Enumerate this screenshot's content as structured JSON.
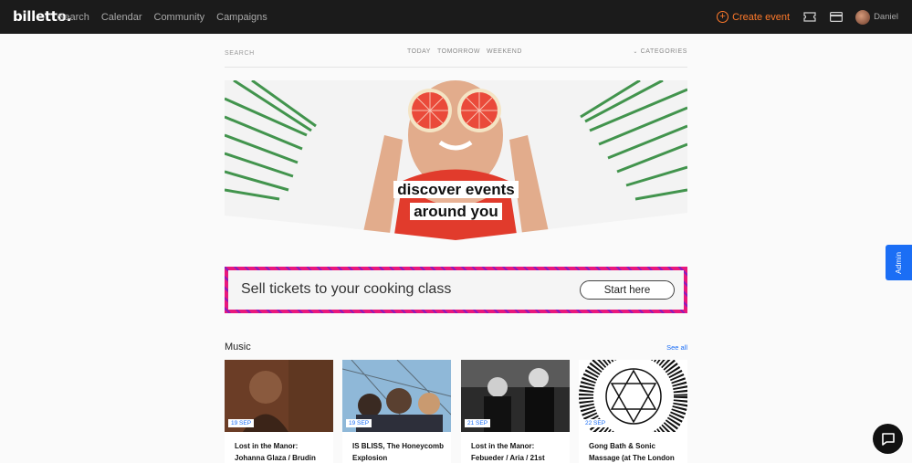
{
  "brand": {
    "logo_text": "billetto."
  },
  "nav": {
    "items": [
      "Search",
      "Calendar",
      "Community",
      "Campaigns"
    ]
  },
  "header_right": {
    "create_label": "Create event",
    "user_name": "Daniel"
  },
  "filters": {
    "search_label": "SEARCH",
    "days": [
      "TODAY",
      "TOMORROW",
      "WEEKEND"
    ],
    "categories_label": "CATEGORIES"
  },
  "hero": {
    "line1": "discover events",
    "line2": "around you"
  },
  "banner": {
    "text": "Sell tickets to your cooking class",
    "button_label": "Start here"
  },
  "admin_tab": {
    "label": "Admin"
  },
  "music": {
    "title": "Music",
    "see_all": "See all",
    "cards": [
      {
        "date": "19 SEP",
        "title": "Lost in the Manor: Johanna Glaza / Brudin"
      },
      {
        "date": "19 SEP",
        "title": "IS BLISS, The Honeycomb Explosion"
      },
      {
        "date": "21 SEP",
        "title": "Lost in the Manor: Febueder / Aria / 21st"
      },
      {
        "date": "22 SEP",
        "title": "Gong Bath & Sonic Massage (at The London"
      }
    ]
  },
  "colors": {
    "accent_orange": "#ff7a2b",
    "link_blue": "#1b6ef5",
    "topbar": "#1b1b1b",
    "banner_magenta": "#e8187c"
  }
}
